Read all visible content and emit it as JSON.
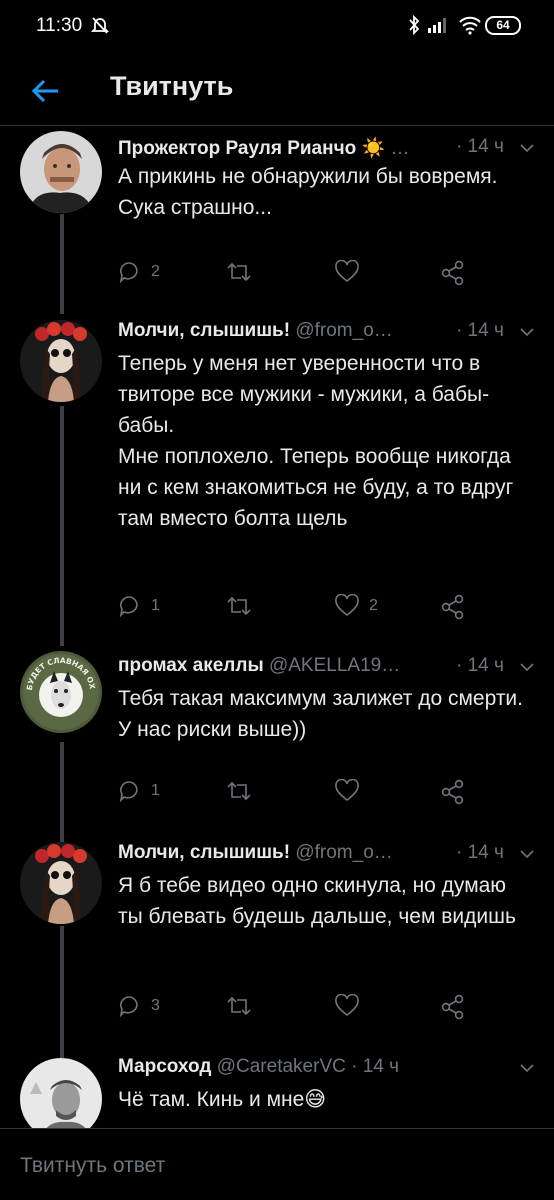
{
  "status_bar": {
    "time": "11:30",
    "battery": "64",
    "icons": [
      "alarm-off-icon",
      "bluetooth-icon",
      "signal-icon",
      "wifi-icon",
      "battery-icon"
    ]
  },
  "app_bar": {
    "title": "Твитнуть",
    "back_icon": "arrow-left-icon"
  },
  "tweets": [
    {
      "name": "Прожектор Рауля Рианчо",
      "emoji": "☀️",
      "handle": "…",
      "time": "· 14 ч",
      "text": "А прикинь не обнаружили бы вовремя. Сука страшно...",
      "replies": "2",
      "retweets": "",
      "likes": ""
    },
    {
      "name": "Молчи, слышишь!",
      "handle": "@from_o…",
      "time": "· 14 ч",
      "text": "Теперь у меня нет уверенности что в твиторе все мужики - мужики, а бабы-бабы.\nМне поплохело. Теперь вообще никогда ни с кем знакомиться не буду, а то вдруг там вместо болта щель",
      "replies": "1",
      "retweets": "",
      "likes": "2"
    },
    {
      "name": "промах акеллы",
      "handle": "@AKELLA19…",
      "time": "· 14 ч",
      "text": "Тебя такая максимум залижет до смерти. У нас риски выше))",
      "replies": "1",
      "retweets": "",
      "likes": "",
      "avatar_text": "ЭТО БУДЕТ СЛАВНАЯ ОХОТА!"
    },
    {
      "name": "Молчи, слышишь!",
      "handle": "@from_o…",
      "time": "· 14 ч",
      "text": "Я б тебе видео одно скинула, но думаю ты блевать будешь дальше, чем видишь",
      "replies": "3",
      "retweets": "",
      "likes": ""
    },
    {
      "name": "Марсоход",
      "handle": "@CaretakerVC",
      "time": "· 14 ч",
      "text": "Чё там. Кинь и мне😅"
    }
  ],
  "reply_bar": {
    "placeholder": "Твитнуть ответ"
  },
  "colors": {
    "background": "#000000",
    "accent": "#1d9bf0",
    "muted": "#6e767d",
    "text": "#e7e9ea"
  }
}
